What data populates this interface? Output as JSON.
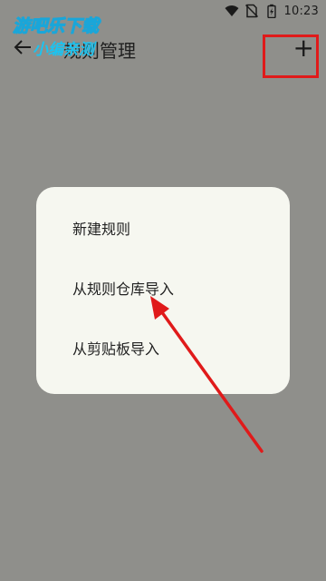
{
  "status_bar": {
    "time": "10:23",
    "icons": [
      "wifi-icon",
      "no-sim-icon",
      "battery-charging-icon"
    ]
  },
  "app_bar": {
    "back_icon": "arrow-left-icon",
    "title": "规则管理",
    "add_icon": "plus-icon",
    "add_label": "+"
  },
  "watermark": {
    "line1": "游吧乐下载",
    "line2": "小编亲测"
  },
  "menu": {
    "items": [
      {
        "label": "新建规则"
      },
      {
        "label": "从规则仓库导入"
      },
      {
        "label": "从剪贴板导入"
      }
    ]
  },
  "colors": {
    "scrim": "#8f8f8b",
    "dialog": "#f6f7f0",
    "highlight": "#e01a1a",
    "watermark_fill": "#ffffff",
    "watermark_accent": "#1cc3f0"
  }
}
